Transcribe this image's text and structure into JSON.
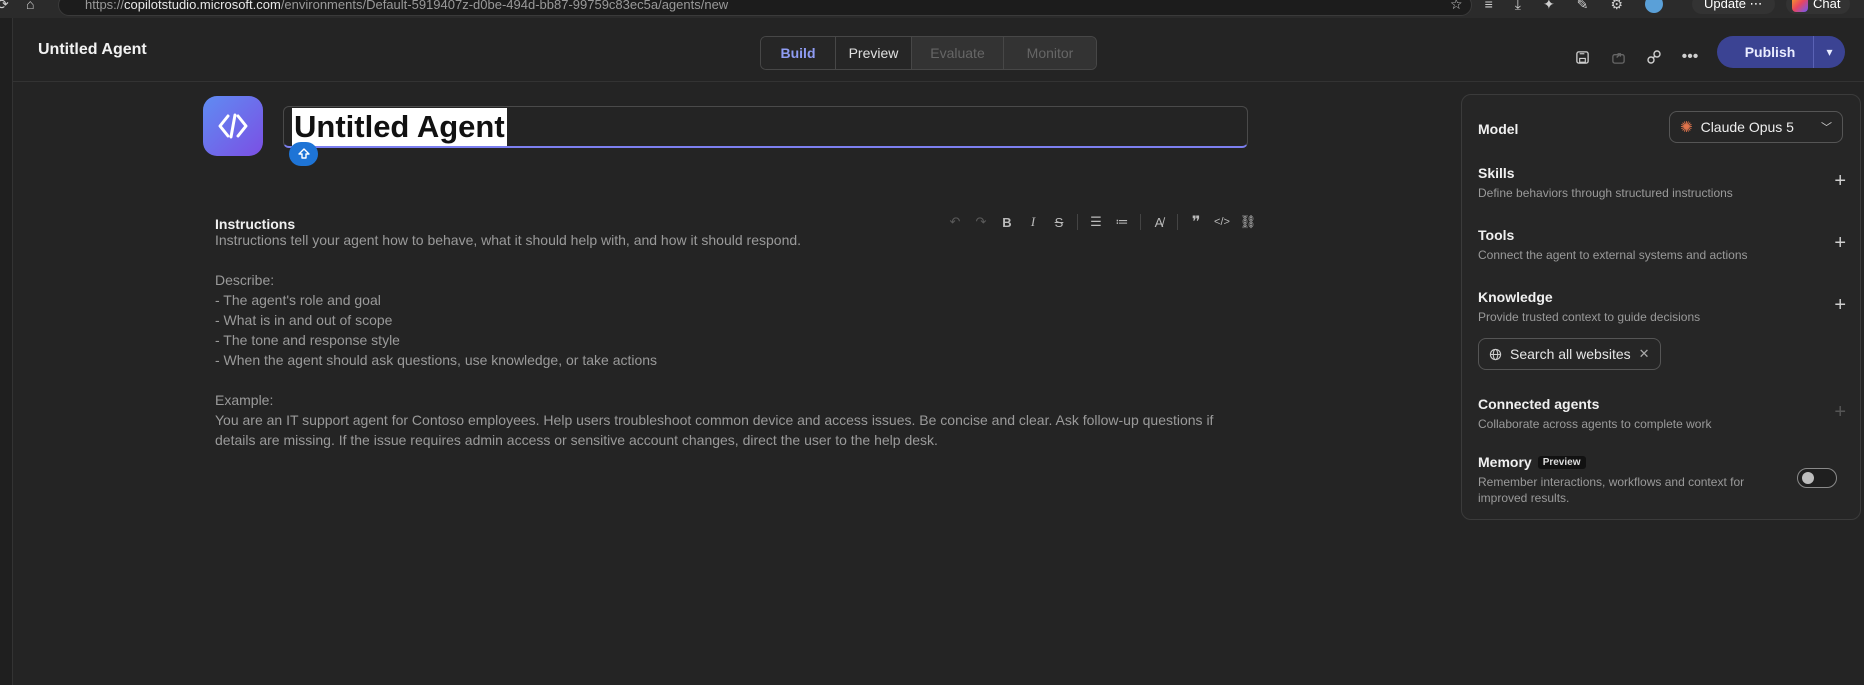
{
  "browser": {
    "url_scheme": "https://",
    "url_host": "copilotstudio.microsoft.com",
    "url_path": "/environments/Default-5919407z-d0be-494d-bb87-99759c83ec5a/agents/new",
    "update_label": "Update",
    "update_more": "⋯",
    "chat_label": "Chat"
  },
  "header": {
    "agent_title": "Untitled Agent",
    "tabs": [
      {
        "label": "Build"
      },
      {
        "label": "Preview"
      },
      {
        "label": "Evaluate"
      },
      {
        "label": "Monitor"
      }
    ],
    "publish_label": "Publish"
  },
  "agent": {
    "name_value": "Untitled Agent"
  },
  "instructions": {
    "label": "Instructions",
    "lines": [
      "Instructions tell your agent how to behave, what it should help with, and how it should respond.",
      "",
      "Describe:",
      "- The agent's role and goal",
      "- What is in and out of scope",
      "- The tone and response style",
      "- When the agent should ask questions, use knowledge, or take actions",
      "",
      "Example:",
      "You are an IT support agent for Contoso employees. Help users troubleshoot common device and access issues. Be concise and clear. Ask follow-up questions if details are missing. If the issue requires admin access or sensitive account changes, direct the user to the help desk."
    ]
  },
  "panel": {
    "model_label": "Model",
    "model_value": "Claude Opus 5",
    "skills": {
      "title": "Skills",
      "desc": "Define behaviors through structured instructions"
    },
    "tools": {
      "title": "Tools",
      "desc": "Connect the agent to external systems and actions"
    },
    "knowledge": {
      "title": "Knowledge",
      "desc": "Provide trusted context to guide decisions",
      "chip": "Search all websites"
    },
    "connected": {
      "title": "Connected agents",
      "desc": "Collaborate across agents to complete work"
    },
    "memory": {
      "title": "Memory",
      "badge": "Preview",
      "desc": "Remember interactions, workflows and context for improved results.",
      "enabled": false
    }
  },
  "colors": {
    "accent": "#8f9cf3",
    "publish_bg": "#3b4393",
    "avatar_gradient": [
      "#5f8cf2",
      "#7b4fe4"
    ],
    "upload_badge": "#1e74d6"
  }
}
